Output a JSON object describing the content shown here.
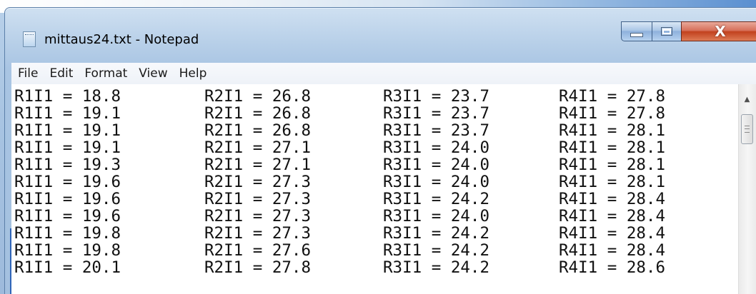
{
  "window": {
    "title": "mittaus24.txt - Notepad",
    "minimize_icon": "minimize-icon",
    "maximize_icon": "maximize-icon",
    "close_icon": "close-icon",
    "close_glyph": "X"
  },
  "menu": {
    "items": [
      "File",
      "Edit",
      "Format",
      "View",
      "Help"
    ]
  },
  "editor": {
    "rows": [
      [
        "R1I1 = 18.8",
        "R2I1 = 26.8",
        "R3I1 = 23.7",
        "R4I1 = 27.8"
      ],
      [
        "R1I1 = 19.1",
        "R2I1 = 26.8",
        "R3I1 = 23.7",
        "R4I1 = 27.8"
      ],
      [
        "R1I1 = 19.1",
        "R2I1 = 26.8",
        "R3I1 = 23.7",
        "R4I1 = 28.1"
      ],
      [
        "R1I1 = 19.1",
        "R2I1 = 27.1",
        "R3I1 = 24.0",
        "R4I1 = 28.1"
      ],
      [
        "R1I1 = 19.3",
        "R2I1 = 27.1",
        "R3I1 = 24.0",
        "R4I1 = 28.1"
      ],
      [
        "R1I1 = 19.6",
        "R2I1 = 27.3",
        "R3I1 = 24.0",
        "R4I1 = 28.1"
      ],
      [
        "R1I1 = 19.6",
        "R2I1 = 27.3",
        "R3I1 = 24.2",
        "R4I1 = 28.4"
      ],
      [
        "R1I1 = 19.6",
        "R2I1 = 27.3",
        "R3I1 = 24.0",
        "R4I1 = 28.4"
      ],
      [
        "R1I1 = 19.8",
        "R2I1 = 27.3",
        "R3I1 = 24.2",
        "R4I1 = 28.4"
      ],
      [
        "R1I1 = 19.8",
        "R2I1 = 27.6",
        "R3I1 = 24.2",
        "R4I1 = 28.4"
      ],
      [
        "R1I1 = 20.1",
        "R2I1 = 27.8",
        "R3I1 = 24.2",
        "R4I1 = 28.6"
      ]
    ]
  },
  "scrollbar": {
    "up_icon": "scroll-up-arrow-icon",
    "thumb_icon": "scroll-thumb-grip-icon"
  }
}
